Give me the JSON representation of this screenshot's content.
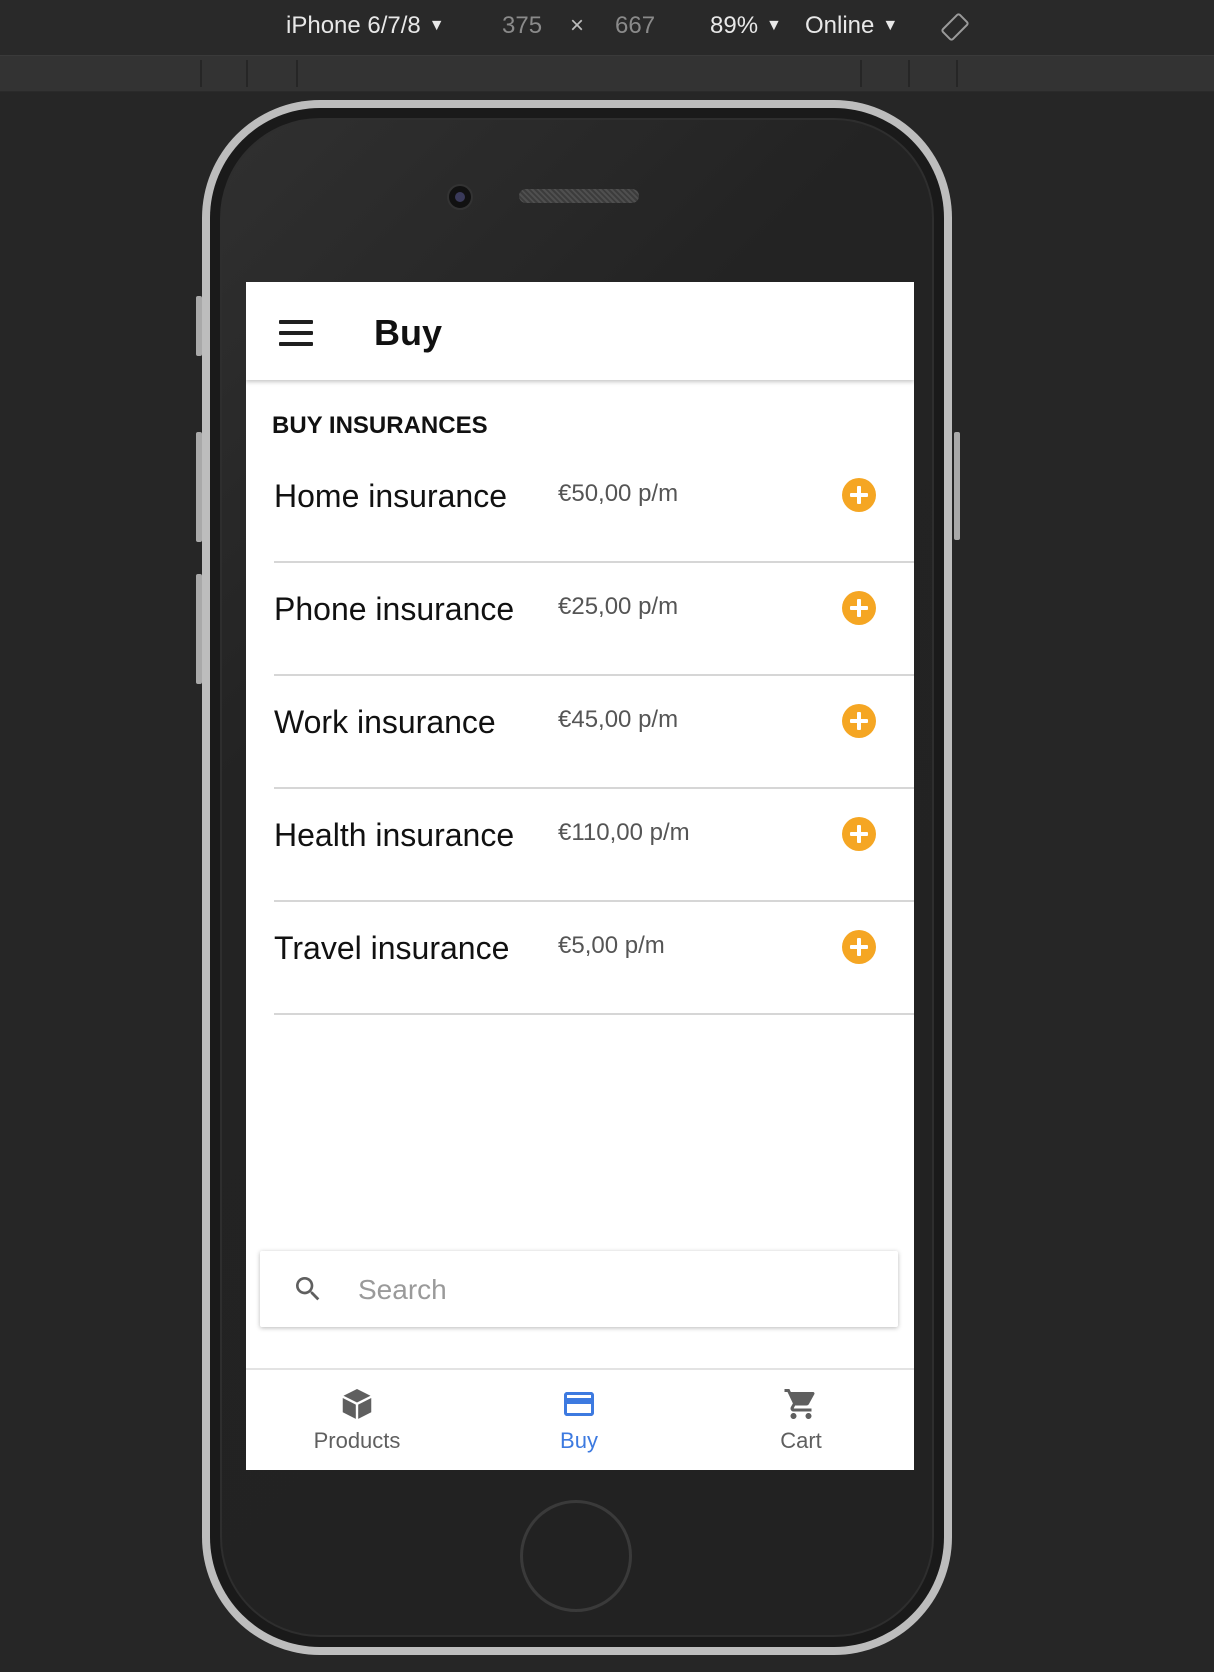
{
  "devtools": {
    "device": "iPhone 6/7/8",
    "width": "375",
    "times": "×",
    "height": "667",
    "zoom": "89%",
    "network": "Online",
    "dropdown_arrow": "▼",
    "rotate_icon": "rotate-icon"
  },
  "app": {
    "title": "Buy",
    "section_title": "BUY INSURANCES",
    "accent_color": "#f5a623",
    "active_color": "#3d7ae0",
    "items": [
      {
        "name": "Home insurance",
        "price": "€50,00 p/m"
      },
      {
        "name": "Phone insurance",
        "price": "€25,00 p/m"
      },
      {
        "name": "Work insurance",
        "price": "€45,00 p/m"
      },
      {
        "name": "Health insurance",
        "price": "€110,00 p/m"
      },
      {
        "name": "Travel insurance",
        "price": "€5,00 p/m"
      }
    ],
    "search": {
      "placeholder": "Search",
      "value": ""
    },
    "nav": [
      {
        "label": "Products",
        "icon": "box-icon",
        "active": false
      },
      {
        "label": "Buy",
        "icon": "credit-card-icon",
        "active": true
      },
      {
        "label": "Cart",
        "icon": "cart-icon",
        "active": false
      }
    ]
  }
}
